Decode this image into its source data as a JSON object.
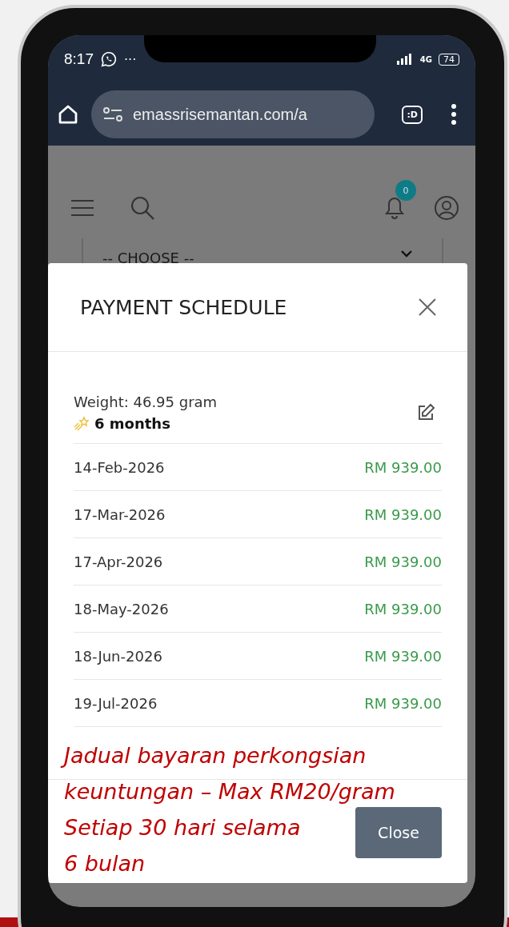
{
  "status_bar": {
    "time": "8:17",
    "more": "···",
    "network": "4G",
    "battery": "74"
  },
  "browser": {
    "url": "emassrisemantan.com/a",
    "tab_switcher": ":D"
  },
  "page_header": {
    "notification_count": "0"
  },
  "select": {
    "value": "-- CHOOSE --"
  },
  "modal": {
    "title": "PAYMENT SCHEDULE",
    "weight": "Weight: 46.95 gram",
    "duration": "6 months",
    "payments": [
      {
        "date": "14-Feb-2026",
        "amount": "RM 939.00"
      },
      {
        "date": "17-Mar-2026",
        "amount": "RM 939.00"
      },
      {
        "date": "17-Apr-2026",
        "amount": "RM 939.00"
      },
      {
        "date": "18-May-2026",
        "amount": "RM 939.00"
      },
      {
        "date": "18-Jun-2026",
        "amount": "RM 939.00"
      },
      {
        "date": "19-Jul-2026",
        "amount": "RM 939.00"
      }
    ],
    "close_button": "Close"
  },
  "annotation": [
    "Jadual bayaran perkongsian",
    "keuntungan – Max RM20/gram",
    "Setiap 30 hari selama",
    "6 bulan"
  ]
}
